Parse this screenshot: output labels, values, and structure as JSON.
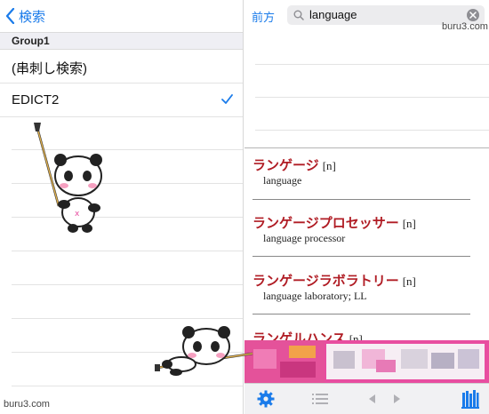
{
  "left": {
    "back_label": "検索",
    "group_title": "Group1",
    "items": [
      {
        "label": "(串刺し検索)",
        "checked": false
      },
      {
        "label": "EDICT2",
        "checked": true
      }
    ]
  },
  "right": {
    "mode_label": "前方",
    "search": {
      "query": "language"
    },
    "entries": [
      {
        "word": "ランゲージ",
        "pos": "[n]",
        "gloss": "language"
      },
      {
        "word": "ランゲージプロセッサー",
        "pos": "[n]",
        "gloss": "language processor"
      },
      {
        "word": "ランゲージラボラトリー",
        "pos": "[n]",
        "gloss": "language laboratory; LL"
      },
      {
        "word": "ランゲルハンス",
        "pos": "[n]",
        "gloss": ""
      }
    ],
    "toolbar": {
      "settings_icon": "gear-icon",
      "list_icon": "list-icon",
      "prev_icon": "triangle-left-icon",
      "next_icon": "triangle-right-icon",
      "library_icon": "books-icon"
    }
  },
  "watermark": "buru3.com",
  "colors": {
    "accent": "#1a7bea",
    "headword": "#b01c24",
    "ad": "#e84da0"
  }
}
